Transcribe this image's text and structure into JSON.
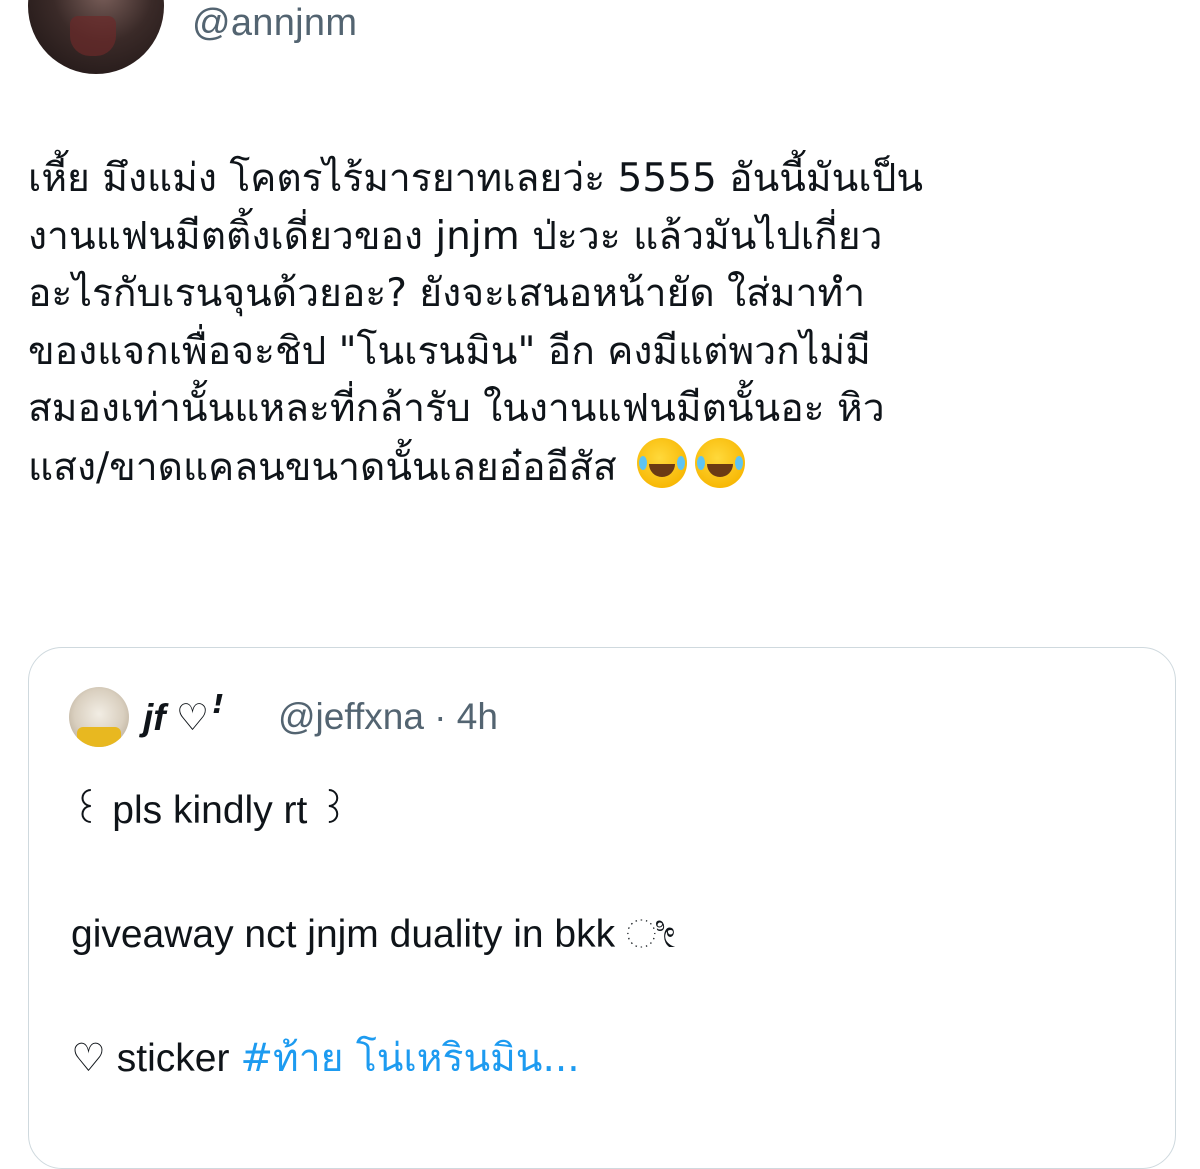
{
  "author": {
    "handle": "@annjnm"
  },
  "tweet": {
    "lines": [
      "เหี้ย มึงแม่ง โคตรไร้มารยาทเลยว่ะ 5555 อันนี้มันเป็น",
      "งานแฟนมีตติ้งเดี่ยวของ jnjm  ป่ะวะ แล้วมันไปเกี่ยว",
      "อะไรกับเรนจุนด้วยอะ? ยังจะเสนอหน้ายัด ใส่มาทำ",
      "ของแจกเพื่อจะชิป \"โนเรนมิน\" อีก คงมีแต่พวกไม่มี",
      "สมองเท่านั้นแหละที่กล้ารับ ในงานแฟนมีตนั้นอะ หิว",
      "แสง/ขาดแคลนขนาดนั้นเลยอ๋ออีสัส"
    ],
    "emojis": [
      "rolling-on-floor-laughing-emoji",
      "rolling-on-floor-laughing-emoji"
    ]
  },
  "quoted_tweet": {
    "display_name": "jf ♡ꜝ",
    "handle_time": "@jeffxna · 4h",
    "line1": "꒰ pls kindly rt ꒱",
    "line2": "giveaway nct jnjm duality in bkk ೀ",
    "line3_prefix": "♡ sticker ",
    "hashtag": "#ท้าย โน่เหรินมิน..."
  },
  "colors": {
    "text": "#0f1419",
    "secondary": "#536471",
    "link": "#1d9bf0",
    "border": "#cfd9de"
  }
}
